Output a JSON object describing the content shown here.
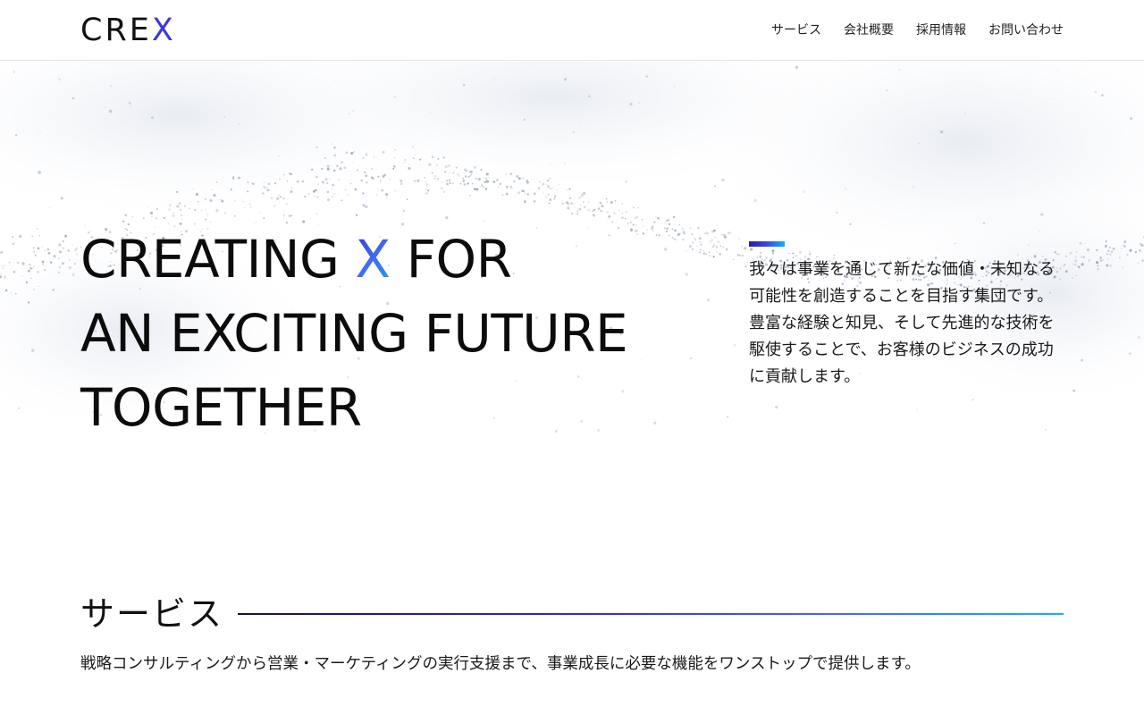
{
  "header": {
    "logo": {
      "prefix": "CRE",
      "mark": "X"
    },
    "nav": [
      "サービス",
      "会社概要",
      "採用情報",
      "お問い合わせ"
    ]
  },
  "hero": {
    "title_line1_before": "CREATING ",
    "title_x": "X",
    "title_line1_after": " FOR",
    "title_line2": "AN EXCITING FUTURE",
    "title_line3": "TOGETHER",
    "paragraph1": "我々は事業を通じて新たな価値・未知なる可能性を創造することを目指す集団です。",
    "paragraph2": "豊富な経験と知見、そして先進的な技術を駆使することで、お客様のビジネスの成功に貢献します。"
  },
  "services": {
    "title": "サービス",
    "description": "戦略コンサルティングから営業・マーケティングの実行支援まで、事業成長に必要な機能をワンストップで提供します。"
  },
  "colors": {
    "accent_dark": "#161048",
    "accent_indigo": "#3b2fd0",
    "accent_cyan": "#13b4ec"
  }
}
